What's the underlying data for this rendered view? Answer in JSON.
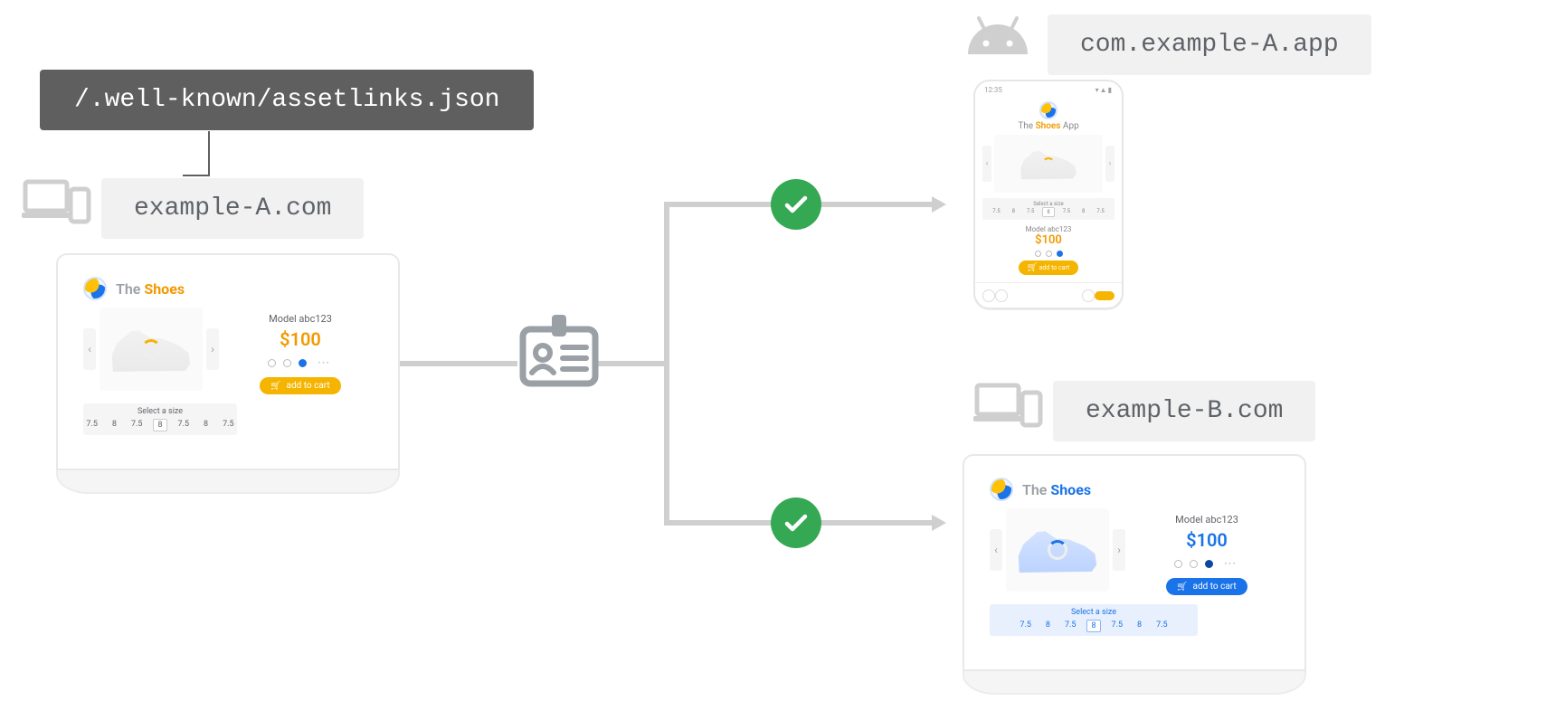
{
  "labels": {
    "assetlinks_path": "/.well-known/assetlinks.json",
    "source_domain": "example-A.com",
    "target_app_package": "com.example-A.app",
    "target_domain": "example-B.com"
  },
  "shop": {
    "brand_prefix": "The ",
    "brand_accent": "Shoes",
    "app_suffix": " App",
    "model": "Model abc123",
    "price": "$100",
    "add_to_cart": "add to cart",
    "select_size": "Select a size",
    "sizes": [
      "7.5",
      "8",
      "7.5",
      "8",
      "7.5",
      "8",
      "7.5"
    ],
    "selected_size_index": 3,
    "phone_time": "12:35"
  },
  "themes": {
    "source_theme": "orange",
    "app_theme": "orange",
    "target_theme": "blue"
  }
}
